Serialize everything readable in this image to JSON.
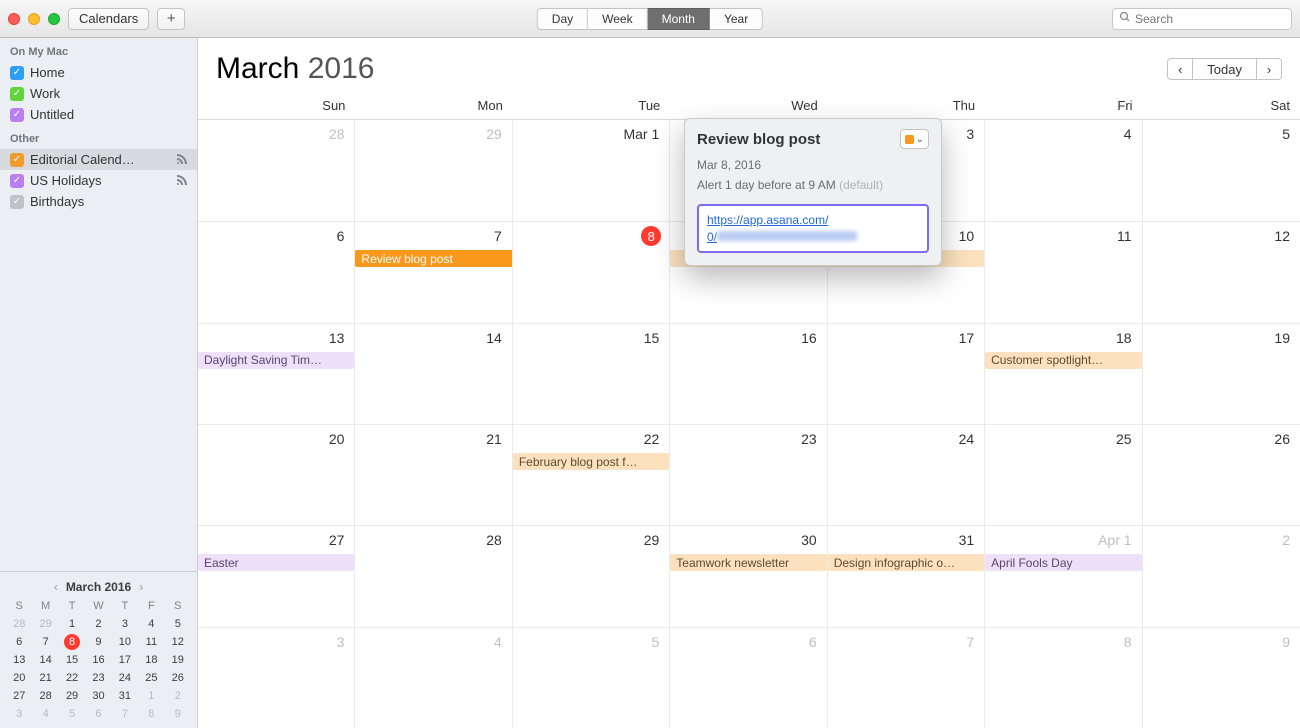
{
  "titlebar": {
    "calendars_btn": "Calendars",
    "views": [
      "Day",
      "Week",
      "Month",
      "Year"
    ],
    "active_view": "Month",
    "search_placeholder": "Search"
  },
  "sidebar": {
    "groups": [
      {
        "label": "On My Mac",
        "items": [
          {
            "color": "blue",
            "checked": true,
            "label": "Home"
          },
          {
            "color": "green",
            "checked": true,
            "label": "Work"
          },
          {
            "color": "purple",
            "checked": true,
            "label": "Untitled"
          }
        ]
      },
      {
        "label": "Other",
        "items": [
          {
            "color": "orange",
            "checked": true,
            "label": "Editorial Calend…",
            "rss": true,
            "selected": true
          },
          {
            "color": "purple",
            "checked": true,
            "label": "US Holidays",
            "rss": true
          },
          {
            "color": "gray",
            "checked": true,
            "label": "Birthdays"
          }
        ]
      }
    ],
    "mini": {
      "title": "March 2016",
      "dow": [
        "S",
        "M",
        "T",
        "W",
        "T",
        "F",
        "S"
      ],
      "rows": [
        [
          "28",
          "29",
          "1",
          "2",
          "3",
          "4",
          "5"
        ],
        [
          "6",
          "7",
          "8",
          "9",
          "10",
          "11",
          "12"
        ],
        [
          "13",
          "14",
          "15",
          "16",
          "17",
          "18",
          "19"
        ],
        [
          "20",
          "21",
          "22",
          "23",
          "24",
          "25",
          "26"
        ],
        [
          "27",
          "28",
          "29",
          "30",
          "31",
          "1",
          "2"
        ],
        [
          "3",
          "4",
          "5",
          "6",
          "7",
          "8",
          "9"
        ]
      ],
      "today": "8",
      "dim_rows": [
        true,
        false,
        false,
        false,
        false,
        true
      ],
      "dim_first_two_r0": true,
      "dim_last_two_r4": true
    }
  },
  "main": {
    "month": "March",
    "year": "2016",
    "today_btn": "Today",
    "dow": [
      "Sun",
      "Mon",
      "Tue",
      "Wed",
      "Thu",
      "Fri",
      "Sat"
    ],
    "weeks": [
      [
        {
          "n": "28"
        },
        {
          "n": "29"
        },
        {
          "n": "Mar 1",
          "cm": true
        },
        {
          "n": "2",
          "cm": true
        },
        {
          "n": "3",
          "cm": true
        },
        {
          "n": "4",
          "cm": true
        },
        {
          "n": "5",
          "cm": true
        }
      ],
      [
        {
          "n": "6",
          "cm": true
        },
        {
          "n": "7",
          "cm": true,
          "ev": {
            "text": "Review blog post",
            "cls": "orange",
            "startsHere": true
          }
        },
        {
          "n": "8",
          "cm": true,
          "today": true
        },
        {
          "n": "9",
          "cm": true,
          "ev": {
            "text": "",
            "cls": "orange-light"
          }
        },
        {
          "n": "10",
          "cm": true,
          "ev": {
            "text": "",
            "cls": "orange-light"
          }
        },
        {
          "n": "11",
          "cm": true
        },
        {
          "n": "12",
          "cm": true
        }
      ],
      [
        {
          "n": "13",
          "cm": true,
          "ev": {
            "text": "Daylight Saving Tim…",
            "cls": "purple-light"
          }
        },
        {
          "n": "14",
          "cm": true
        },
        {
          "n": "15",
          "cm": true
        },
        {
          "n": "16",
          "cm": true
        },
        {
          "n": "17",
          "cm": true
        },
        {
          "n": "18",
          "cm": true,
          "ev": {
            "text": "Customer spotlight…",
            "cls": "orange-light"
          }
        },
        {
          "n": "19",
          "cm": true
        }
      ],
      [
        {
          "n": "20",
          "cm": true
        },
        {
          "n": "21",
          "cm": true
        },
        {
          "n": "22",
          "cm": true,
          "ev": {
            "text": "February blog post f…",
            "cls": "orange-light"
          }
        },
        {
          "n": "23",
          "cm": true
        },
        {
          "n": "24",
          "cm": true
        },
        {
          "n": "25",
          "cm": true
        },
        {
          "n": "26",
          "cm": true
        }
      ],
      [
        {
          "n": "27",
          "cm": true,
          "ev": {
            "text": "Easter",
            "cls": "purple-light"
          }
        },
        {
          "n": "28",
          "cm": true
        },
        {
          "n": "29",
          "cm": true
        },
        {
          "n": "30",
          "cm": true,
          "ev": {
            "text": "Teamwork newsletter",
            "cls": "orange-light"
          }
        },
        {
          "n": "31",
          "cm": true,
          "ev": {
            "text": "Design infographic o…",
            "cls": "orange-light"
          }
        },
        {
          "n": "Apr 1",
          "ev": {
            "text": "April Fools Day",
            "cls": "purple-light"
          }
        },
        {
          "n": "2"
        }
      ],
      [
        {
          "n": "3"
        },
        {
          "n": "4"
        },
        {
          "n": "5"
        },
        {
          "n": "6"
        },
        {
          "n": "7"
        },
        {
          "n": "8"
        },
        {
          "n": "9"
        }
      ]
    ]
  },
  "popover": {
    "title": "Review blog post",
    "date": "Mar 8, 2016",
    "alert": "Alert 1 day before at 9 AM ",
    "alert_default": "(default)",
    "url_line1": "https://app.asana.com/",
    "url_line2": "0/"
  }
}
